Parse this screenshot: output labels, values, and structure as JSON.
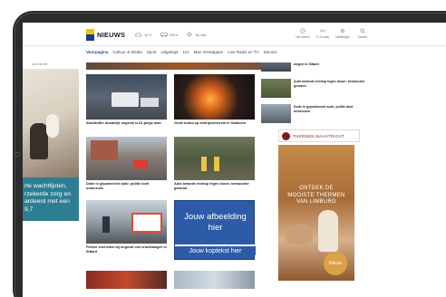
{
  "site": {
    "name": "NIEUWS",
    "colors": {
      "brand_blue": "#1c3d8c",
      "brand_yellow": "#f5c400",
      "accent_nav": "#1c4fa0"
    }
  },
  "header": {
    "weather": [
      {
        "icon": "cloud-sun-icon",
        "label": "11°C"
      },
      {
        "icon": "traffic-icon",
        "label": "File's"
      },
      {
        "icon": "sun-icon",
        "label": "Tip wtk"
      }
    ],
    "utilities": [
      {
        "icon": "clock-icon",
        "label": "Net binnen"
      },
      {
        "icon": "radio-icon",
        "label": "Tv & radio"
      },
      {
        "icon": "settings-icon",
        "label": "Instellingen"
      },
      {
        "icon": "search-icon",
        "label": "Zoeken"
      }
    ]
  },
  "nav": {
    "items": [
      "Voorpagina",
      "Cultuur & Media",
      "Sport",
      "Uitgelegd",
      "112",
      "Max Verstappen",
      "Live Radio en TV",
      "Service"
    ],
    "active_index": 0
  },
  "left_ad": {
    "label": "advertentie",
    "brand": "cortoclinics",
    "text_lines": [
      "rte wachtlijsten,",
      "rzekerde zorg en",
      "ardeerd met een 9,7"
    ]
  },
  "articles": [
    {
      "caption": "Slachtoffer doodelijk ongeval is 81-jarige man"
    },
    {
      "caption": "Grote brand op bedrijventerrein in Swalmen"
    },
    {
      "caption": "Dode in geparkeerde auto: politie doet onderzoek"
    },
    {
      "caption": "Auto belandt rechtop tegen boom: bestuurder gewond"
    },
    {
      "caption": "Fietser overleden bij ongeval met vrachtwagen in Sittard"
    }
  ],
  "promo": {
    "title_line1": "Jouw afbeelding",
    "title_line2": "hier",
    "subtitle": "Jouw koptekst hier"
  },
  "right_list": [
    {
      "title": "wegen in Sittard"
    },
    {
      "title": "Auto belandt rechtop tegen boom: bestuurder gewond"
    },
    {
      "title": "Dode in geparkeerde auto: politie doet onderzoek"
    }
  ],
  "thermen_ad": {
    "brand": "THERMEN MAASTRICHT",
    "headline_lines": [
      "ONTDEK DE",
      "MOOISTE THERMEN",
      "VAN LIMBURG"
    ],
    "badge": "Nieuw"
  }
}
